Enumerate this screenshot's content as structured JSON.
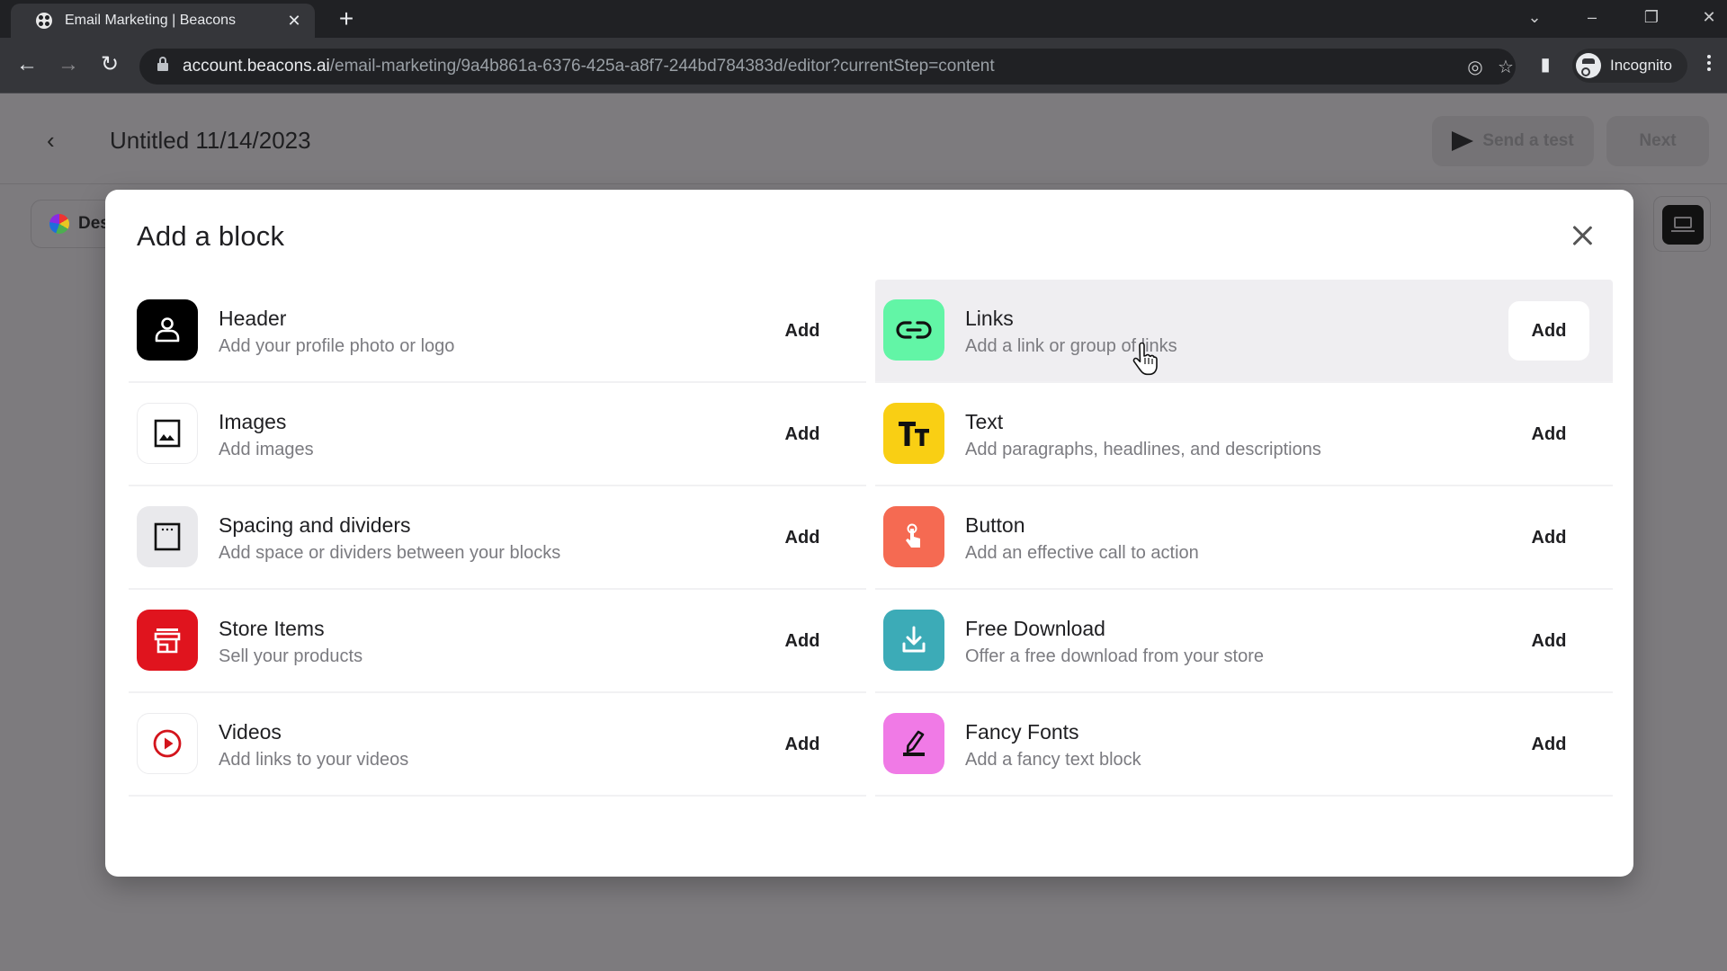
{
  "browser": {
    "tab_title": "Email Marketing | Beacons",
    "new_tab_icon": "plus-icon",
    "url_host": "account.beacons.ai",
    "url_path": "/email-marketing/9a4b861a-6376-425a-a8f7-244bd784383d/editor?currentStep=content",
    "profile_label": "Incognito",
    "window_controls": [
      "tab-search-icon",
      "minimize-icon",
      "restore-icon",
      "close-icon"
    ],
    "omnibox_icons": [
      "eye-off-icon",
      "star-icon"
    ],
    "toolbar_icons": [
      "back-icon",
      "forward-icon",
      "reload-icon",
      "side-panel-icon",
      "menu-icon"
    ]
  },
  "app": {
    "document_title": "Untitled 11/14/2023",
    "send_test_label": "Send a test",
    "next_label": "Next",
    "design_label": "Des"
  },
  "modal": {
    "title": "Add a block",
    "close_icon": "close-icon",
    "add_label": "Add",
    "left_column": [
      {
        "name": "Header",
        "description": "Add your profile photo or logo",
        "icon": "person-icon",
        "color": "#000000"
      },
      {
        "name": "Images",
        "description": "Add images",
        "icon": "image-icon",
        "color": "#ffffff"
      },
      {
        "name": "Spacing and dividers",
        "description": "Add space or dividers between your blocks",
        "icon": "spacing-icon",
        "color": "#e9e9ec"
      },
      {
        "name": "Store Items",
        "description": "Sell your products",
        "icon": "storefront-icon",
        "color": "#e0141e"
      },
      {
        "name": "Videos",
        "description": "Add links to your videos",
        "icon": "play-circle-icon",
        "color": "#ffffff"
      }
    ],
    "right_column": [
      {
        "name": "Links",
        "description": "Add a link or group of links",
        "icon": "link-icon",
        "color": "#62f5a6",
        "hovered": true
      },
      {
        "name": "Text",
        "description": "Add paragraphs, headlines, and descriptions",
        "icon": "text-size-icon",
        "color": "#f9cf14"
      },
      {
        "name": "Button",
        "description": "Add an effective call to action",
        "icon": "tap-icon",
        "color": "#f56a52"
      },
      {
        "name": "Free Download",
        "description": "Offer a free download from your store",
        "icon": "download-icon",
        "color": "#3cabb7"
      },
      {
        "name": "Fancy Fonts",
        "description": "Add a fancy text block",
        "icon": "pencil-icon",
        "color": "#f07ae6"
      }
    ]
  }
}
